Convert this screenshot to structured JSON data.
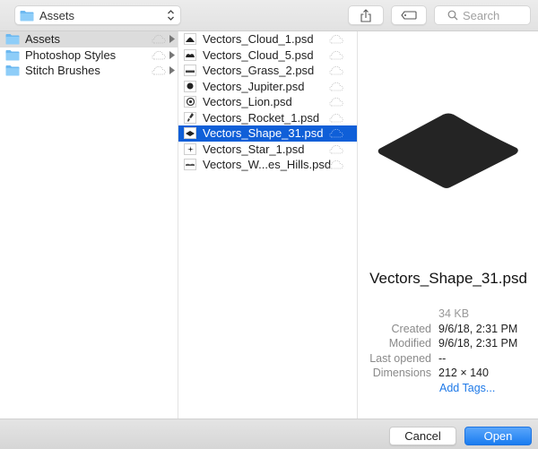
{
  "toolbar": {
    "location": "Assets",
    "search_placeholder": "Search",
    "share_icon": "share-icon",
    "tag_icon": "tag-icon"
  },
  "sidebar": {
    "items": [
      {
        "label": "Assets",
        "icon": "folder-icon",
        "active": true
      },
      {
        "label": "Photoshop Styles",
        "icon": "folder-icon",
        "active": false
      },
      {
        "label": "Stitch Brushes",
        "icon": "folder-icon",
        "active": false
      }
    ]
  },
  "files": {
    "items": [
      {
        "label": "Vectors_Cloud_1.psd",
        "selected": false
      },
      {
        "label": "Vectors_Cloud_5.psd",
        "selected": false
      },
      {
        "label": "Vectors_Grass_2.psd",
        "selected": false
      },
      {
        "label": "Vectors_Jupiter.psd",
        "selected": false
      },
      {
        "label": "Vectors_Lion.psd",
        "selected": false
      },
      {
        "label": "Vectors_Rocket_1.psd",
        "selected": false
      },
      {
        "label": "Vectors_Shape_31.psd",
        "selected": true
      },
      {
        "label": "Vectors_Star_1.psd",
        "selected": false
      },
      {
        "label": "Vectors_W...es_Hills.psd",
        "selected": false
      }
    ]
  },
  "preview": {
    "title": "Vectors_Shape_31.psd",
    "size": "34 KB",
    "created_label": "Created",
    "created": "9/6/18, 2:31 PM",
    "modified_label": "Modified",
    "modified": "9/6/18, 2:31 PM",
    "last_opened_label": "Last opened",
    "last_opened": "--",
    "dimensions_label": "Dimensions",
    "dimensions": "212 × 140",
    "add_tags": "Add Tags..."
  },
  "buttons": {
    "cancel": "Cancel",
    "open": "Open"
  },
  "colors": {
    "selection": "#0f5fd8",
    "accent": "#1a7cf0",
    "link": "#1f7ae8"
  }
}
